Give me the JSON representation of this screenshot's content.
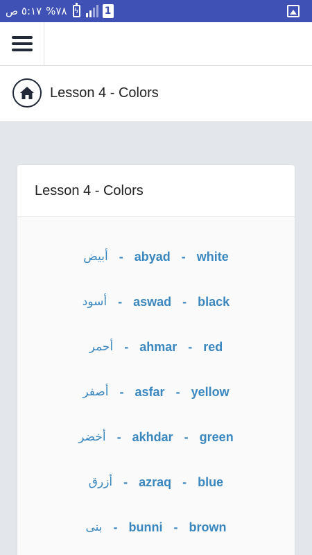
{
  "status_bar": {
    "time": "٥:١٧ ص",
    "battery_text": "%٧٨",
    "sim_label": "1",
    "icons": [
      "battery-icon",
      "signal-icon",
      "sim-icon",
      "image-icon"
    ]
  },
  "header": {
    "menu_icon": "hamburger-menu-icon"
  },
  "title_bar": {
    "home_icon": "home-icon",
    "title": "Lesson 4 - Colors"
  },
  "card": {
    "title": "Lesson 4 - Colors",
    "separator": "-",
    "items": [
      {
        "arabic": "أبيض",
        "transliteration": "abyad",
        "english": "white"
      },
      {
        "arabic": "أسود",
        "transliteration": "aswad",
        "english": "black"
      },
      {
        "arabic": "أحمر",
        "transliteration": "ahmar",
        "english": "red"
      },
      {
        "arabic": "أصفر",
        "transliteration": "asfar",
        "english": "yellow"
      },
      {
        "arabic": "أخضر",
        "transliteration": "akhdar",
        "english": "green"
      },
      {
        "arabic": "أزرق",
        "transliteration": "azraq",
        "english": "blue"
      },
      {
        "arabic": "بنى",
        "transliteration": "bunni",
        "english": "brown"
      }
    ]
  },
  "colors": {
    "status_bar": "#3f51b5",
    "text_accent": "#3a87c0",
    "background": "#e3e6ea",
    "icon_dark": "#222a3a"
  }
}
